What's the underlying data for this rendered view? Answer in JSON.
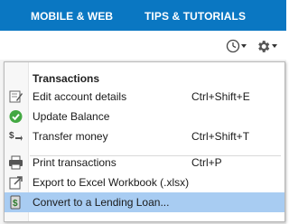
{
  "topnav": {
    "links": [
      {
        "label": "MOBILE & WEB"
      },
      {
        "label": "TIPS & TUTORIALS"
      }
    ],
    "background": "#0a77c2"
  },
  "toolbar": {
    "buttons": [
      {
        "icon": "clock-icon"
      },
      {
        "icon": "gear-icon"
      }
    ]
  },
  "menu": {
    "header": "Transactions",
    "items": [
      {
        "label": "Edit account details",
        "shortcut": "Ctrl+Shift+E",
        "icon": "edit-icon"
      },
      {
        "label": "Update Balance",
        "shortcut": "",
        "icon": "check-circle-icon"
      },
      {
        "label": "Transfer money",
        "shortcut": "Ctrl+Shift+T",
        "icon": "transfer-money-icon"
      },
      {
        "label": "Print transactions",
        "shortcut": "Ctrl+P",
        "icon": "printer-icon"
      },
      {
        "label": "Export to Excel Workbook (.xlsx)",
        "shortcut": "",
        "icon": "export-icon"
      },
      {
        "label": "Convert to a Lending Loan...",
        "shortcut": "",
        "icon": "loan-icon",
        "selected": true
      }
    ],
    "highlight_color": "#a8ccf2"
  }
}
